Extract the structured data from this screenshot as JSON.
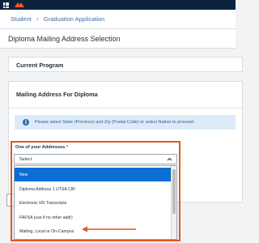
{
  "navbar": {
    "menu_icon": "apps-grid-icon",
    "logo_icon": "university-logo-icon",
    "background": "#0c2340"
  },
  "breadcrumb": {
    "items": [
      "Student",
      "Graduation Application"
    ],
    "separator": "›"
  },
  "page": {
    "title": "Diploma Mailing Address Selection"
  },
  "current_program": {
    "title": "Current Program"
  },
  "mailing": {
    "title": "Mailing Address For Diploma",
    "info_icon": "info-icon",
    "info_text": "Please select State (Province) and Zip (Postal Code) or select Nation to proceed."
  },
  "address_field": {
    "label": "One of your Addresses",
    "required_mark": "*",
    "value": "Select",
    "chevron_icon": "chevron-up-icon",
    "options": [
      {
        "label": "New",
        "selected": true
      },
      {
        "label": "Diploma Address 1 UTSA CIR",
        "selected": false
      },
      {
        "label": "Electronic HS Transcripts",
        "selected": false
      },
      {
        "label": "FAFSA (use if no other addr)",
        "selected": false
      },
      {
        "label": "Mailing, Local or On-Campus",
        "selected": false
      }
    ]
  },
  "colors": {
    "accent": "#e2571d",
    "selected_option": "#0b6fd4",
    "info_bg": "#dcebf7",
    "link": "#3a6fa8"
  }
}
